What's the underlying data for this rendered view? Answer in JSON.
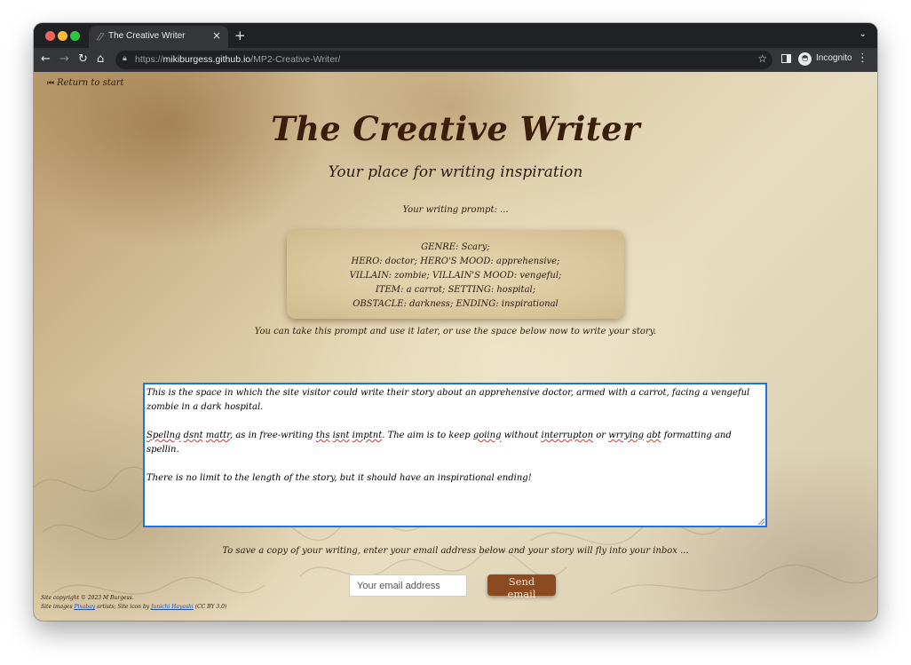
{
  "browser": {
    "tab_title": "The Creative Writer",
    "tab_close": "×",
    "new_tab": "+",
    "url_scheme": "https://",
    "url_host": "mikiburgess.github.io",
    "url_path": "/MP2-Creative-Writer/",
    "profile_label": "Incognito"
  },
  "nav": {
    "return_label": "Return to start"
  },
  "header": {
    "title": "The Creative Writer",
    "subtitle": "Your place for writing inspiration"
  },
  "prompt": {
    "label": "Your writing prompt: ...",
    "lines": [
      "GENRE: Scary;",
      "HERO: doctor; HERO'S MOOD: apprehensive;",
      "VILLAIN: zombie; VILLAIN'S MOOD: vengeful;",
      "ITEM: a carrot; SETTING: hospital;",
      "OBSTACLE: darkness; ENDING: inspirational"
    ],
    "note": "You can take this prompt and use it later, or use the space below now to write your story."
  },
  "story": {
    "para1": "This is the space in which the site visitor could write their story about an apprehensive doctor, armed with a carrot, facing a vengeful zombie in a dark hospital.",
    "para2_parts": [
      "Spellng",
      " ",
      "dsnt",
      " ",
      "mattr",
      ", as in free-writing ",
      "ths",
      " ",
      "isnt",
      " ",
      "imptnt",
      ". The aim is to keep ",
      "goiing",
      " without ",
      "interrupton",
      " or ",
      "wrrying",
      " ",
      "abt",
      " formatting and spellin."
    ],
    "para3": "There is no limit to the length of the story, but it should have an inspirational ending!"
  },
  "email": {
    "save_note": "To save a copy of your writing, enter your email address below and your story will fly into your inbox ...",
    "placeholder": "Your email address",
    "send_label": "Send email"
  },
  "footer": {
    "copyright": "Site copyright © 2023 M Burgess.",
    "images_prefix": "Site images ",
    "pixabay": "Pixabay",
    "images_mid": " artists; Site icon by ",
    "icon_author": "Junichi Hayashi",
    "license": " (CC BY 3.0)"
  },
  "colors": {
    "title": "#3a1d0b",
    "button": "#8b4a20",
    "focus_ring": "#1a73e8"
  }
}
